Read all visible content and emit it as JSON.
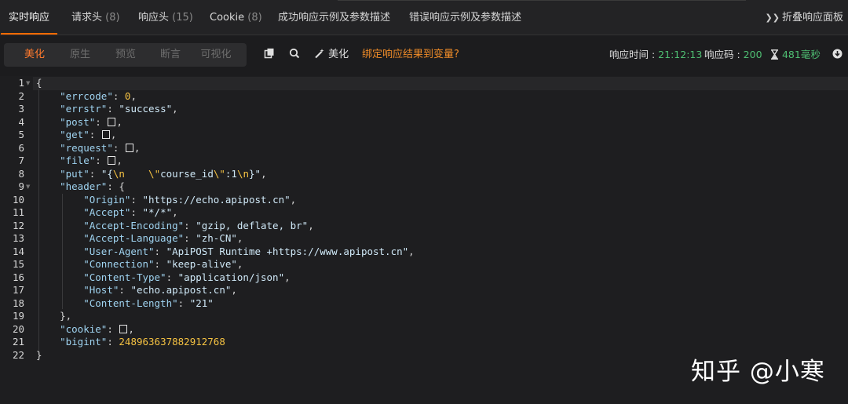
{
  "tabs": [
    {
      "label": "实时响应",
      "count": ""
    },
    {
      "label": "请求头",
      "count": "(8)"
    },
    {
      "label": "响应头",
      "count": "(15)"
    },
    {
      "label": "Cookie",
      "count": "(8)"
    },
    {
      "label": "成功响应示例及参数描述",
      "count": ""
    },
    {
      "label": "错误响应示例及参数描述",
      "count": ""
    }
  ],
  "collapse_label": "折叠响应面板",
  "view_modes": [
    "美化",
    "原生",
    "预览",
    "断言",
    "可视化"
  ],
  "toolbar": {
    "beautify_label": "美化",
    "bind_link": "绑定响应结果到变量?"
  },
  "stats": {
    "time_label": "响应时间 : ",
    "time_value": "21:12:13",
    "code_label": "响应码 : ",
    "code_value": "200",
    "duration_value": "481毫秒"
  },
  "colors": {
    "accent": "#ff6a00",
    "link": "#f08c28",
    "success": "#4fbf73",
    "number": "#f5c242",
    "key": "#9fd3f0"
  },
  "icons": [
    "copy-icon",
    "search-icon",
    "magic-wand-icon",
    "hourglass-icon",
    "download-icon",
    "collapse-icon"
  ],
  "line_numbers": [
    "1",
    "2",
    "3",
    "4",
    "5",
    "6",
    "7",
    "8",
    "9",
    "10",
    "11",
    "12",
    "13",
    "14",
    "15",
    "16",
    "17",
    "18",
    "19",
    "20",
    "21",
    "22"
  ],
  "code": {
    "errcode_key": "\"errcode\"",
    "errcode_val": "0",
    "errstr_key": "\"errstr\"",
    "errstr_val": "\"success\"",
    "post_key": "\"post\"",
    "get_key": "\"get\"",
    "request_key": "\"request\"",
    "file_key": "\"file\"",
    "put_key": "\"put\"",
    "put_val_a": "\"{",
    "put_esc1": "\\n",
    "put_val_b": "    ",
    "put_esc2": "\\\"",
    "put_val_c": "course_id",
    "put_esc3": "\\\"",
    "put_val_d": ":1",
    "put_esc4": "\\n",
    "put_val_e": "}\"",
    "header_key": "\"header\"",
    "headers": [
      {
        "k": "\"Origin\"",
        "v": "\"https://echo.apipost.cn\""
      },
      {
        "k": "\"Accept\"",
        "v": "\"*/*\""
      },
      {
        "k": "\"Accept-Encoding\"",
        "v": "\"gzip, deflate, br\""
      },
      {
        "k": "\"Accept-Language\"",
        "v": "\"zh-CN\""
      },
      {
        "k": "\"User-Agent\"",
        "v": "\"ApiPOST Runtime +https://www.apipost.cn\""
      },
      {
        "k": "\"Connection\"",
        "v": "\"keep-alive\""
      },
      {
        "k": "\"Content-Type\"",
        "v": "\"application/json\""
      },
      {
        "k": "\"Host\"",
        "v": "\"echo.apipost.cn\""
      },
      {
        "k": "\"Content-Length\"",
        "v": "\"21\""
      }
    ],
    "cookie_key": "\"cookie\"",
    "bigint_key": "\"bigint\"",
    "bigint_val": "248963637882912768"
  },
  "watermark": "知乎 @小寒"
}
